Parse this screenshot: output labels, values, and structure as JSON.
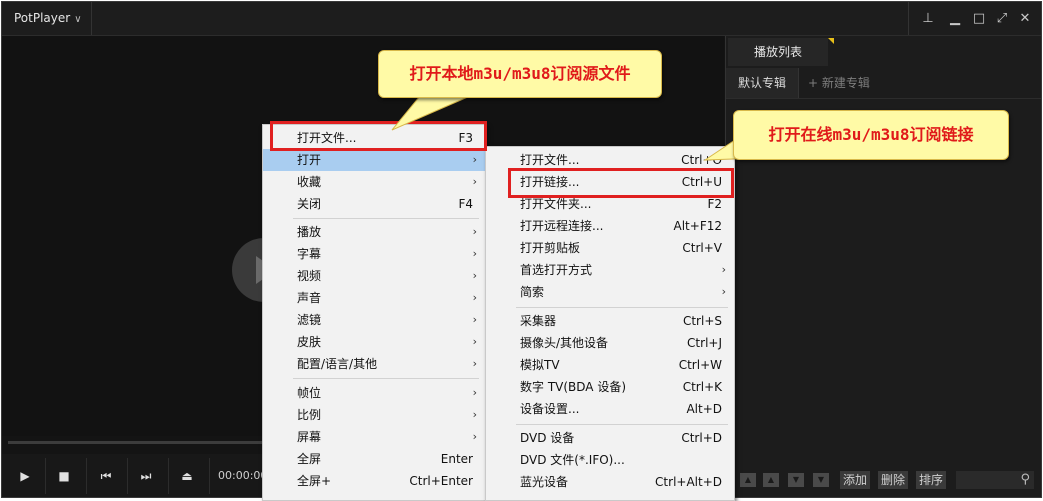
{
  "titlebar": {
    "app_name": "PotPlayer",
    "chevron": "∨",
    "pin": "⊥",
    "minimize": "▁",
    "maximize": "□",
    "fullscreen": "⤢",
    "close": "✕"
  },
  "controls": {
    "play": "▶",
    "stop": "■",
    "prev": "⏮",
    "next": "⏭",
    "eject": "⏏",
    "time": "00:00:00"
  },
  "playlist": {
    "tab_label": "播放列表",
    "album_tab": "默认专辑",
    "add_album": "+ 新建专辑",
    "add_button": "添加",
    "delete_button": "删除",
    "sort_button": "排序",
    "search_icon": "⚲"
  },
  "main_menu": {
    "items": [
      {
        "label": "打开文件...",
        "shortcut": "F3"
      },
      {
        "label": "打开",
        "arrow": "›"
      },
      {
        "label": "收藏",
        "arrow": "›"
      },
      {
        "label": "关闭",
        "shortcut": "F4"
      },
      {
        "label": "播放",
        "arrow": "›"
      },
      {
        "label": "字幕",
        "arrow": "›"
      },
      {
        "label": "视频",
        "arrow": "›"
      },
      {
        "label": "声音",
        "arrow": "›"
      },
      {
        "label": "滤镜",
        "arrow": "›"
      },
      {
        "label": "皮肤",
        "arrow": "›"
      },
      {
        "label": "配置/语言/其他",
        "arrow": "›"
      },
      {
        "label": "帧位",
        "arrow": "›"
      },
      {
        "label": "比例",
        "arrow": "›"
      },
      {
        "label": "屏幕",
        "arrow": "›"
      },
      {
        "label": "全屏",
        "shortcut": "Enter"
      },
      {
        "label": "全屏+",
        "shortcut": "Ctrl+Enter"
      }
    ]
  },
  "submenu": {
    "items": [
      {
        "label": "打开文件...",
        "shortcut": "Ctrl+O"
      },
      {
        "label": "打开链接...",
        "shortcut": "Ctrl+U"
      },
      {
        "label": "打开文件夹...",
        "shortcut": "F2"
      },
      {
        "label": "打开远程连接...",
        "shortcut": "Alt+F12"
      },
      {
        "label": "打开剪贴板",
        "shortcut": "Ctrl+V"
      },
      {
        "label": "首选打开方式",
        "arrow": "›"
      },
      {
        "label": "简索",
        "arrow": "›"
      },
      {
        "label": "采集器",
        "shortcut": "Ctrl+S"
      },
      {
        "label": "摄像头/其他设备",
        "shortcut": "Ctrl+J"
      },
      {
        "label": "模拟TV",
        "shortcut": "Ctrl+W"
      },
      {
        "label": "数字 TV(BDA 设备)",
        "shortcut": "Ctrl+K"
      },
      {
        "label": "设备设置...",
        "shortcut": "Alt+D"
      },
      {
        "label": "DVD 设备",
        "shortcut": "Ctrl+D"
      },
      {
        "label": "DVD 文件(*.IFO)..."
      },
      {
        "label": "蓝光设备",
        "shortcut": "Ctrl+Alt+D"
      }
    ]
  },
  "callouts": {
    "local": "打开本地m3u/m3u8订阅源文件",
    "online": "打开在线m3u/m3u8订阅链接"
  },
  "colors": {
    "accent_red": "#e02020",
    "callout_bg": "#fffaa6",
    "menu_highlight": "#a9cdf0"
  }
}
